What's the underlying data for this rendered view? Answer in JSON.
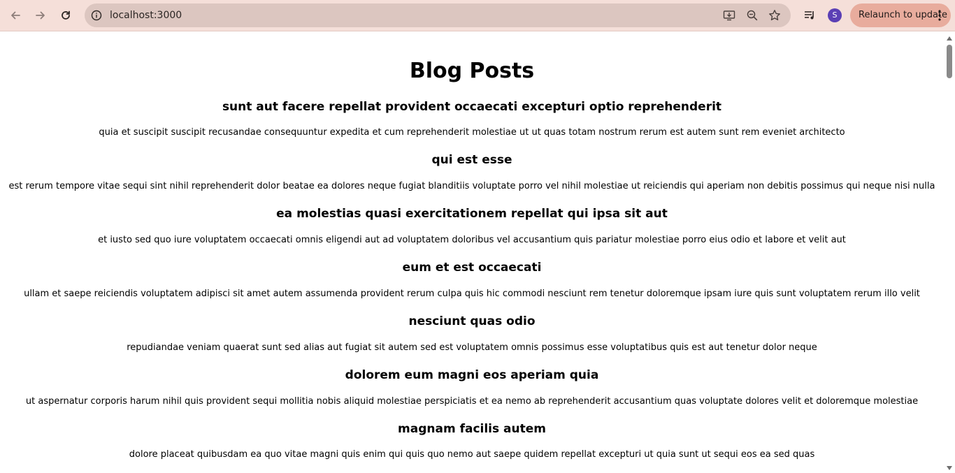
{
  "browser": {
    "url": "localhost:3000",
    "profile_initial": "S",
    "relaunch_label": "Relaunch to update",
    "icons": {
      "back": "back-arrow-icon",
      "forward": "forward-arrow-icon",
      "reload": "reload-icon",
      "site_info": "info-icon",
      "install": "install-app-icon",
      "zoom": "zoom-icon",
      "bookmark": "star-icon",
      "media": "media-queue-icon",
      "menu": "kebab-menu-icon"
    },
    "colors": {
      "toolbar": "#f5dfd9",
      "omnibox": "#dcc6c0",
      "relaunch": "#e8ac9d",
      "avatar": "#5b3fb5"
    }
  },
  "page": {
    "title": "Blog Posts",
    "posts": [
      {
        "title": "sunt aut facere repellat provident occaecati excepturi optio reprehenderit",
        "body": "quia et suscipit suscipit recusandae consequuntur expedita et cum reprehenderit molestiae ut ut quas totam nostrum rerum est autem sunt rem eveniet architecto"
      },
      {
        "title": "qui est esse",
        "body": "est rerum tempore vitae sequi sint nihil reprehenderit dolor beatae ea dolores neque fugiat blanditiis voluptate porro vel nihil molestiae ut reiciendis qui aperiam non debitis possimus qui neque nisi nulla"
      },
      {
        "title": "ea molestias quasi exercitationem repellat qui ipsa sit aut",
        "body": "et iusto sed quo iure voluptatem occaecati omnis eligendi aut ad voluptatem doloribus vel accusantium quis pariatur molestiae porro eius odio et labore et velit aut"
      },
      {
        "title": "eum et est occaecati",
        "body": "ullam et saepe reiciendis voluptatem adipisci sit amet autem assumenda provident rerum culpa quis hic commodi nesciunt rem tenetur doloremque ipsam iure quis sunt voluptatem rerum illo velit"
      },
      {
        "title": "nesciunt quas odio",
        "body": "repudiandae veniam quaerat sunt sed alias aut fugiat sit autem sed est voluptatem omnis possimus esse voluptatibus quis est aut tenetur dolor neque"
      },
      {
        "title": "dolorem eum magni eos aperiam quia",
        "body": "ut aspernatur corporis harum nihil quis provident sequi mollitia nobis aliquid molestiae perspiciatis et ea nemo ab reprehenderit accusantium quas voluptate dolores velit et doloremque molestiae"
      },
      {
        "title": "magnam facilis autem",
        "body": "dolore placeat quibusdam ea quo vitae magni quis enim qui quis quo nemo aut saepe quidem repellat excepturi ut quia sunt ut sequi eos ea sed quas"
      }
    ]
  }
}
